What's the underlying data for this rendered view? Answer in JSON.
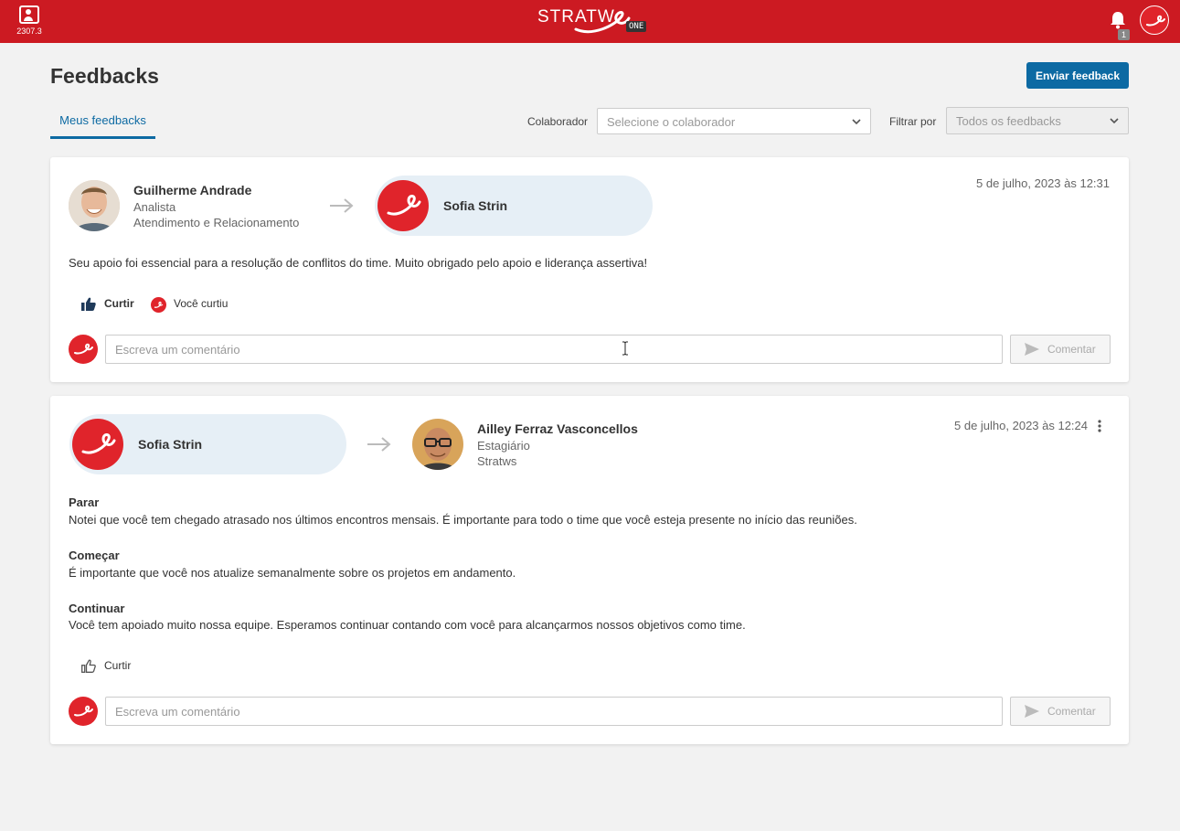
{
  "topbar": {
    "version": "2307.3",
    "logo_text": "STRATW",
    "logo_badge": "ONE",
    "notification_count": "1",
    "brand_color": "#cc1a22"
  },
  "header": {
    "title": "Feedbacks",
    "send_button": "Enviar feedback",
    "tab_label": "Meus feedbacks",
    "colaborador_label": "Colaborador",
    "colaborador_placeholder": "Selecione o colaborador",
    "filter_label": "Filtrar por",
    "filter_value": "Todos os feedbacks"
  },
  "feedbacks": [
    {
      "from": {
        "name": "Guilherme Andrade",
        "role": "Analista",
        "department": "Atendimento e Relacionamento"
      },
      "to": {
        "name": "Sofia Strin"
      },
      "date": "5 de julho, 2023 às 12:31",
      "message": "Seu apoio foi essencial para a resolução de conflitos do time. Muito obrigado pelo apoio e liderança assertiva!",
      "like_label": "Curtir",
      "liked_label": "Você curtiu",
      "comment_placeholder": "Escreva um comentário",
      "comment_button": "Comentar"
    },
    {
      "from": {
        "name": "Sofia Strin"
      },
      "to": {
        "name": "Ailley Ferraz Vasconcellos",
        "role": "Estagiário",
        "department": "Stratws"
      },
      "date": "5 de julho, 2023 às 12:24",
      "sections": [
        {
          "title": "Parar",
          "text": "Notei que você tem chegado atrasado nos últimos encontros mensais. É importante para todo o time que você esteja presente no início das reuniões."
        },
        {
          "title": "Começar",
          "text": "É importante que você nos atualize semanalmente sobre os projetos em andamento."
        },
        {
          "title": "Continuar",
          "text": "Você tem apoiado muito nossa equipe. Esperamos continuar contando com você para alcançarmos nossos objetivos como time."
        }
      ],
      "like_label": "Curtir",
      "comment_placeholder": "Escreva um comentário",
      "comment_button": "Comentar"
    }
  ]
}
